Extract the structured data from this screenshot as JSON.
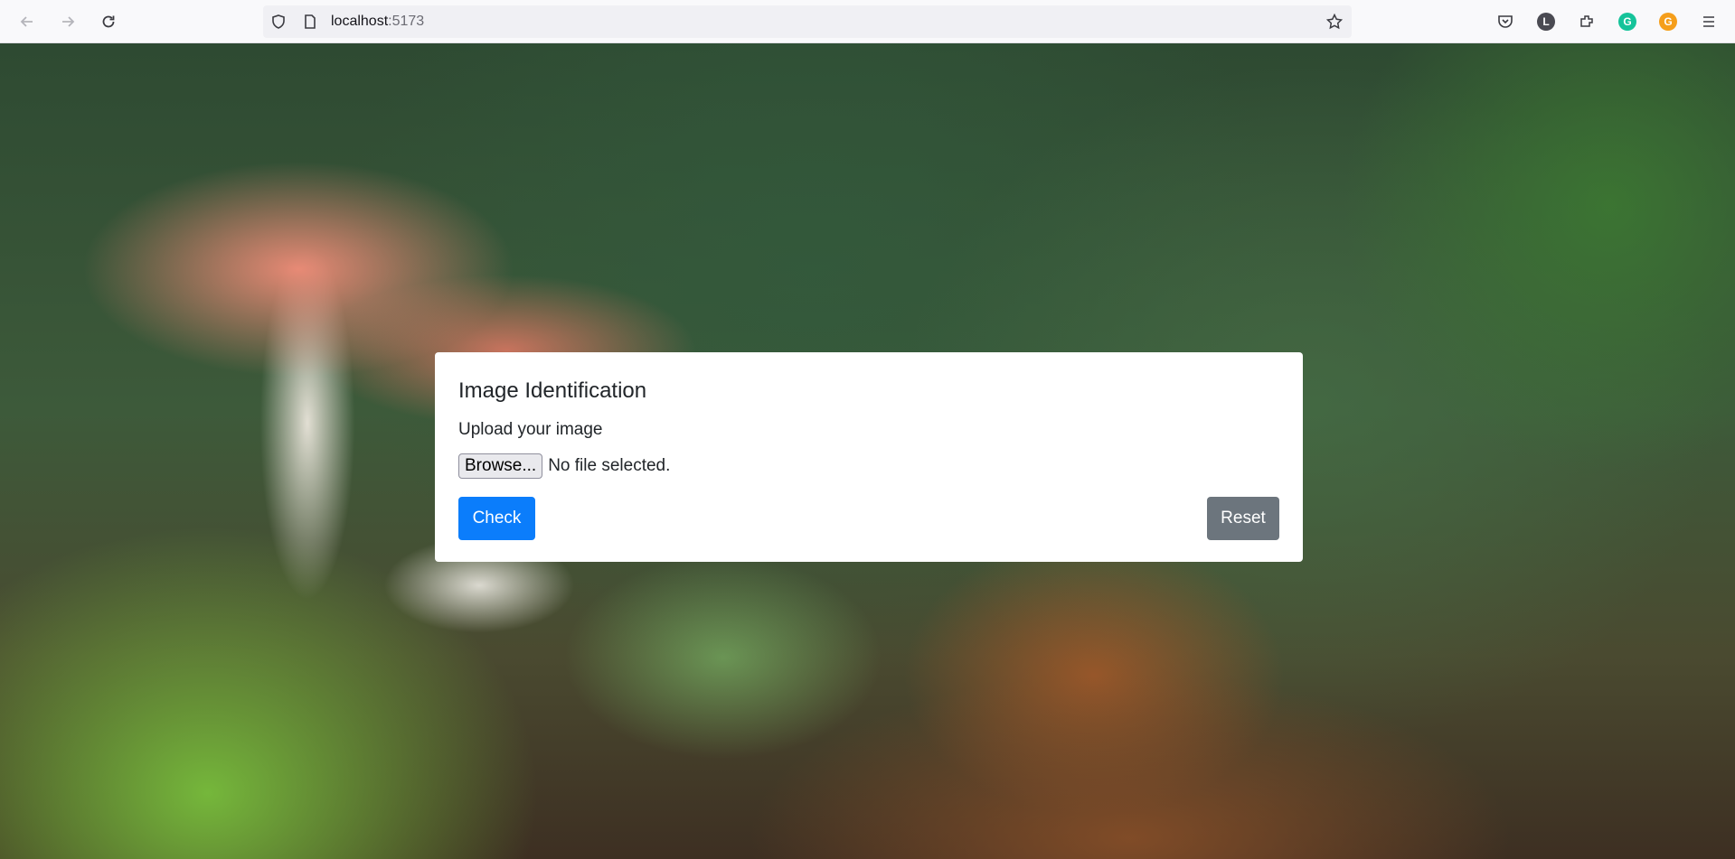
{
  "browser": {
    "url_host": "localhost",
    "url_port": ":5173",
    "profile_initial": "L",
    "grammarly_letter": "G"
  },
  "card": {
    "title": "Image Identification",
    "upload_label": "Upload your image",
    "browse_label": "Browse...",
    "file_status": "No file selected.",
    "check_label": "Check",
    "reset_label": "Reset"
  },
  "colors": {
    "primary": "#0b7dfb",
    "secondary": "#6c757d"
  }
}
